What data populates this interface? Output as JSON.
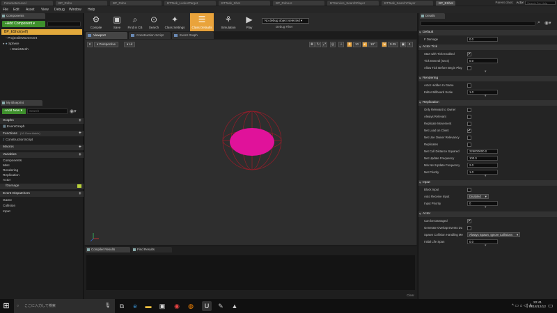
{
  "tabs": [
    {
      "label": "ParameterLevel"
    },
    {
      "label": "BP_Robo"
    },
    {
      "label": "BP_Robo"
    },
    {
      "label": "BTTask_LookAtTarget"
    },
    {
      "label": "BTTask_Shot"
    },
    {
      "label": "BP_RoboAI"
    },
    {
      "label": "BTService_SearchPlayer"
    },
    {
      "label": "BTTask_SearchPlayer"
    },
    {
      "label": "BP_EShot"
    }
  ],
  "header": {
    "parent_class_label": "Parent class:",
    "parent_class_value": "Actor",
    "help_search_placeholder": "Search For Help"
  },
  "menu": [
    "File",
    "Edit",
    "Asset",
    "View",
    "Debug",
    "Window",
    "Help"
  ],
  "components": {
    "tab_label": "Components",
    "add_button": "+Add Component ▾",
    "self_item": "BP_EShot(self)",
    "items": [
      "ProjectileMovement",
      "Sphere",
      "StaticMesh"
    ]
  },
  "my_blueprint": {
    "tab_label": "My Blueprint",
    "add_new": "+Add New ▾",
    "search_placeholder": "Search",
    "graphs_header": "Graphs",
    "graph_items": [
      "EventGraph"
    ],
    "functions_header": "Functions",
    "functions_sub": "(16 Overridable)",
    "function_items": [
      "ConstructionScript"
    ],
    "macros_header": "Macros",
    "variables_header": "Variables",
    "variable_groups": [
      "Components",
      "Misc",
      "Rendering",
      "Replication",
      "Actor"
    ],
    "variable_items": [
      "fDamage"
    ],
    "dispatchers_header": "Event Dispatchers",
    "dispatcher_groups": [
      "Game",
      "Collision",
      "Input"
    ]
  },
  "toolbar": {
    "buttons": [
      {
        "label": "Compile",
        "icon": "compile-icon"
      },
      {
        "label": "Save",
        "icon": "save-icon"
      },
      {
        "label": "Find in CB",
        "icon": "search-icon"
      },
      {
        "label": "Search",
        "icon": "binoculars-icon"
      },
      {
        "label": "Class Settings",
        "icon": "gear-icon"
      },
      {
        "label": "Class Defaults",
        "icon": "defaults-icon"
      },
      {
        "label": "Simulation",
        "icon": "simulation-icon"
      },
      {
        "label": "Play",
        "icon": "play-icon"
      }
    ],
    "debug_select": "No debug object selected ▾",
    "debug_label": "Debug Filter"
  },
  "editor_tabs": [
    "Viewport",
    "Construction Script",
    "Event Graph"
  ],
  "viewport": {
    "perspective": "Perspective",
    "lit": "Lit",
    "grid_snap": "10",
    "rot_snap": "10°",
    "scale_snap": "0.25",
    "cam_speed": "4",
    "sphere_color": "#e0129a",
    "wire_color": "#9a1c2a"
  },
  "compiler": {
    "tab_label": "Compiler Results",
    "find_label": "Find Results",
    "clear": "Clear"
  },
  "details": {
    "tab_label": "Details",
    "sections": [
      {
        "header": "Default",
        "rows": [
          {
            "label": "F Damage",
            "type": "field",
            "value": "0.0"
          }
        ]
      },
      {
        "header": "Actor Tick",
        "rows": [
          {
            "label": "Start with Tick Enabled",
            "type": "check",
            "value": "✔"
          },
          {
            "label": "Tick Interval (secs)",
            "type": "field",
            "value": "0.0"
          },
          {
            "label": "Allow Tick Before Begin Play",
            "type": "check",
            "value": ""
          }
        ]
      },
      {
        "header": "Rendering",
        "rows": [
          {
            "label": "Actor Hidden In Game",
            "type": "check",
            "value": ""
          },
          {
            "label": "Editor Billboard Scale",
            "type": "field",
            "value": "1.0"
          }
        ]
      },
      {
        "header": "Replication",
        "rows": [
          {
            "label": "Only Relevant to Owner",
            "type": "check",
            "value": ""
          },
          {
            "label": "Always Relevant",
            "type": "check",
            "value": ""
          },
          {
            "label": "Replicate Movement",
            "type": "check",
            "value": ""
          },
          {
            "label": "Net Load on Client",
            "type": "check",
            "value": "✔"
          },
          {
            "label": "Net Use Owner Relevancy",
            "type": "check",
            "value": ""
          },
          {
            "label": "Replicates",
            "type": "check",
            "value": ""
          },
          {
            "label": "Net Cull Distance Squared",
            "type": "field",
            "value": "225000000.0"
          },
          {
            "label": "Net Update Frequency",
            "type": "field",
            "value": "100.0"
          },
          {
            "label": "Min Net Update Frequency",
            "type": "field",
            "value": "2.0"
          },
          {
            "label": "Net Priority",
            "type": "field",
            "value": "1.0"
          }
        ]
      },
      {
        "header": "Input",
        "rows": [
          {
            "label": "Block Input",
            "type": "check",
            "value": ""
          },
          {
            "label": "Auto Receive Input",
            "type": "combo",
            "value": "Disabled"
          },
          {
            "label": "Input Priority",
            "type": "field",
            "value": "0"
          }
        ]
      },
      {
        "header": "Actor",
        "rows": [
          {
            "label": "Can be Damaged",
            "type": "check",
            "value": "✔"
          },
          {
            "label": "Generate Overlap Events Du",
            "type": "check",
            "value": ""
          },
          {
            "label": "Spawn Collision Handling Me",
            "type": "combo",
            "value": "Always Spawn, Ignore Collisions"
          },
          {
            "label": "Initial Life Span",
            "type": "field",
            "value": "0.0"
          }
        ]
      }
    ]
  },
  "taskbar": {
    "search_placeholder": "ここに入力して検索",
    "apps": [
      "task-view-icon",
      "edge-icon",
      "explorer-icon",
      "store-icon",
      "chrome-icon",
      "firefox-icon",
      "unreal-icon",
      "app-icon",
      "photos-icon"
    ],
    "time": "22:41",
    "date": "2018/12/12"
  }
}
